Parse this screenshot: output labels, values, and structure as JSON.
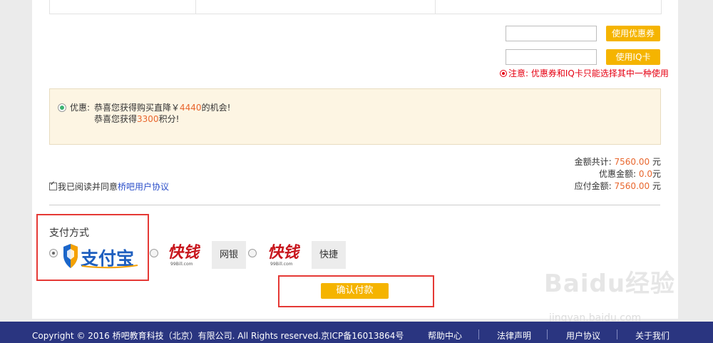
{
  "coupon": {
    "button_label": "使用优惠券",
    "input_value": ""
  },
  "iqcard": {
    "button_label": "使用IQ卡",
    "input_value": ""
  },
  "notice": "注意: 优惠券和IQ卡只能选择其中一种使用",
  "promo": {
    "label": "优惠:",
    "line1_prefix": "恭喜您获得购买直降￥",
    "line1_amount": "4440",
    "line1_suffix": "的机会!",
    "line2_prefix": "恭喜您获得",
    "line2_points": "3300",
    "line2_suffix": "积分!"
  },
  "totals": {
    "total_label": "金额共计:",
    "total_value": "7560.00",
    "total_unit": "元",
    "discount_label": "优惠金额:",
    "discount_value": "0.0",
    "discount_unit": "元",
    "payable_label": "应付金额:",
    "payable_value": "7560.00",
    "payable_unit": "元"
  },
  "agreement": {
    "text": "我已阅读并同意",
    "link": "桥吧用户协议",
    "checked": true
  },
  "payment": {
    "title": "支付方式",
    "alipay_text": "支付宝",
    "kuaiqian_text": "快钱",
    "kuaiqian_sub": "99Bill.com",
    "netbank_label": "网银",
    "quick_label": "快捷",
    "selected": "alipay"
  },
  "confirm_label": "确认付款",
  "footer": {
    "copyright": "Copyright © 2016 桥吧教育科技（北京）有限公司. All Rights reserved.京ICP备16013864号",
    "links": [
      "帮助中心",
      "法律声明",
      "用户协议",
      "关于我们"
    ]
  },
  "watermark": {
    "brand": "Baidu经验",
    "url": "jingyan.baidu.com"
  },
  "colors": {
    "accent": "#f5b400",
    "highlight": "#e8662d",
    "warning": "#e60012",
    "footer_bg": "#2a3580",
    "link": "#2b4fc9"
  }
}
